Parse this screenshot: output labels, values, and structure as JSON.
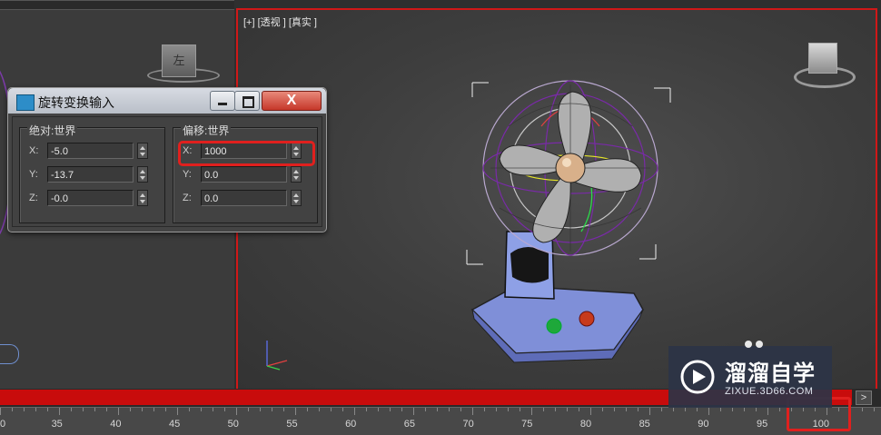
{
  "viewport_right": {
    "label": "[+] [透视 ] [真实 ]",
    "accent_border": "#d01818"
  },
  "viewport_left": {
    "viewcube_face": "左"
  },
  "dialog": {
    "title": "旋转变换输入",
    "close_glyph": "X",
    "absolute_group": {
      "title": "绝对:世界",
      "rows": [
        {
          "axis": "X:",
          "value": "-5.0"
        },
        {
          "axis": "Y:",
          "value": "-13.7"
        },
        {
          "axis": "Z:",
          "value": "-0.0"
        }
      ]
    },
    "offset_group": {
      "title": "偏移:世界",
      "rows": [
        {
          "axis": "X:",
          "value": "1000"
        },
        {
          "axis": "Y:",
          "value": "0.0"
        },
        {
          "axis": "Z:",
          "value": "0.0"
        }
      ]
    }
  },
  "timeline": {
    "next_button": ">",
    "ticks": [
      "0",
      "35",
      "40",
      "45",
      "50",
      "55",
      "60",
      "65",
      "70",
      "75",
      "80",
      "85",
      "90",
      "95",
      "100"
    ],
    "slider_color": "#c80c0c"
  },
  "watermark": {
    "name": "溜溜自学",
    "url": "ZIXUE.3D66.COM"
  },
  "colors": {
    "highlight": "#e0201e",
    "dialog_title_bg": "#c9ced6"
  }
}
